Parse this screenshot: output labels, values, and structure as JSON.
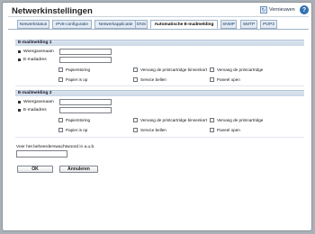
{
  "header": {
    "title": "Netwerkinstellingen",
    "refresh_label": "Vernieuwen",
    "help_label": "?"
  },
  "tabs": [
    {
      "label": "Netwerkstatus"
    },
    {
      "label": "IPv6-configuratie"
    },
    {
      "label": "Netwerkapplicatie"
    },
    {
      "label": "DNS"
    },
    {
      "label": "Automatische E-mailmelding"
    },
    {
      "label": "SNMP"
    },
    {
      "label": "SMTP"
    },
    {
      "label": "POP3"
    }
  ],
  "sections": [
    {
      "title": "E-mailmelding 1",
      "display_name_label": "Weergavenaam",
      "email_label": "E-mailadres",
      "display_name_value": "",
      "email_value": "",
      "options": [
        {
          "label": "Papierstoring",
          "checked": false
        },
        {
          "label": "Vervang de printcartridge binnenkort",
          "checked": false
        },
        {
          "label": "Vervang de printcartridge",
          "checked": false
        },
        {
          "label": "Papier is op",
          "checked": false
        },
        {
          "label": "Service bellen",
          "checked": false
        },
        {
          "label": "Paneel open",
          "checked": false
        }
      ]
    },
    {
      "title": "E-mailmelding 2",
      "display_name_label": "Weergavenaam",
      "email_label": "E-mailadres",
      "display_name_value": "",
      "email_value": "",
      "options": [
        {
          "label": "Papierstoring",
          "checked": false
        },
        {
          "label": "Vervang de printcartridge binnenkort",
          "checked": false
        },
        {
          "label": "Vervang de printcartridge",
          "checked": false
        },
        {
          "label": "Papier is op",
          "checked": false
        },
        {
          "label": "Service bellen",
          "checked": false
        },
        {
          "label": "Paneel open",
          "checked": false
        }
      ]
    }
  ],
  "admin_password": {
    "label": "Voer het beheerderswachtwoord in a.u.b.",
    "value": ""
  },
  "buttons": {
    "ok": "OK",
    "cancel": "Annuleren"
  },
  "colors": {
    "tab_bg": "#e3ebf4",
    "section_header_bg": "#cdd9e7",
    "background": "#a9b0b6"
  }
}
